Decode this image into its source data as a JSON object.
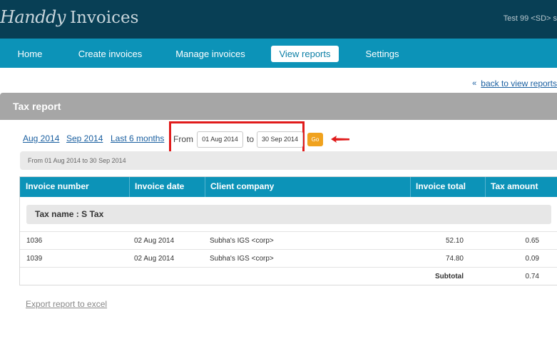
{
  "app": {
    "logo_script": "Handdy",
    "logo_plain": "Invoices",
    "user_info": "Test 99 <SD> s"
  },
  "nav": {
    "items": [
      {
        "label": "Home"
      },
      {
        "label": "Create invoices"
      },
      {
        "label": "Manage invoices"
      },
      {
        "label": "View reports",
        "active": true
      },
      {
        "label": "Settings"
      }
    ]
  },
  "back_link": {
    "icon": "double-left-arrow-icon",
    "label": "back to view reports"
  },
  "panel": {
    "title": "Tax report"
  },
  "filters": {
    "quick_links": [
      "Aug 2014",
      "Sep 2014",
      "Last 6 months"
    ],
    "from_label": "From",
    "from_value": "01 Aug 2014",
    "to_label": "to",
    "to_value": "30 Sep 2014",
    "go_label": "Go",
    "range_text": "From 01 Aug 2014 to 30 Sep 2014"
  },
  "colors": {
    "topbar": "#083f55",
    "navbar": "#0c93b8",
    "accent_orange": "#f0a21e",
    "highlight_red": "#e01b1b"
  },
  "table": {
    "headers": [
      "Invoice number",
      "Invoice date",
      "Client company",
      "Invoice total",
      "Tax amount"
    ],
    "tax_name": "Tax name : S Tax",
    "rows": [
      {
        "number": "1036",
        "date": "02 Aug 2014",
        "client": "Subha's IGS <corp>",
        "total": "52.10",
        "tax": "0.65"
      },
      {
        "number": "1039",
        "date": "02 Aug 2014",
        "client": "Subha's IGS <corp>",
        "total": "74.80",
        "tax": "0.09"
      }
    ],
    "subtotal_label": "Subtotal",
    "subtotal_value": "0.74"
  },
  "export": {
    "label": "Export report to excel"
  }
}
